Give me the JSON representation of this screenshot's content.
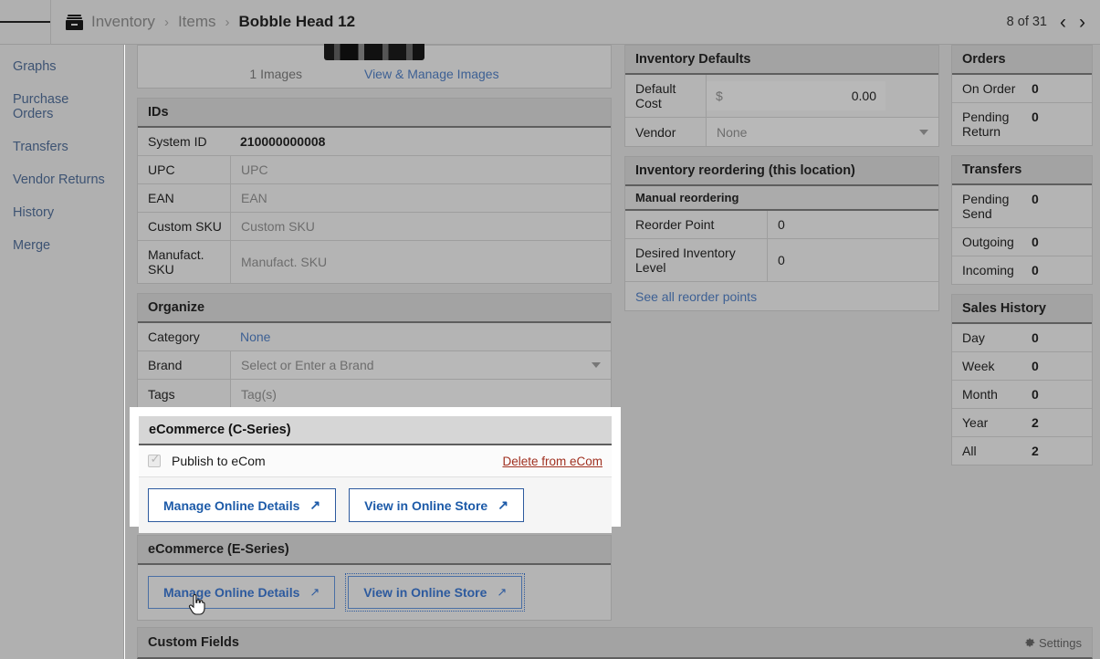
{
  "topbar": {
    "menu_icon": "hamburger-icon",
    "inventory_icon": "inventory-box-icon",
    "breadcrumb": [
      "Inventory",
      "Items",
      "Bobble Head 12"
    ],
    "separator": "›",
    "pager_count": "8 of 31",
    "prev_icon": "‹",
    "next_icon": "›"
  },
  "sidebar": {
    "items": [
      {
        "label": "Graphs"
      },
      {
        "label": "Purchase Orders"
      },
      {
        "label": "Transfers"
      },
      {
        "label": "Vendor Returns"
      },
      {
        "label": "History"
      },
      {
        "label": "Merge"
      }
    ]
  },
  "images": {
    "count_label": "1 Images",
    "manage_link": "View & Manage Images"
  },
  "ids": {
    "title": "IDs",
    "rows": [
      {
        "label": "System ID",
        "value": "210000000008",
        "bold": true
      },
      {
        "label": "UPC",
        "value": "UPC",
        "placeholder": true
      },
      {
        "label": "EAN",
        "value": "EAN",
        "placeholder": true
      },
      {
        "label": "Custom SKU",
        "value": "Custom SKU",
        "placeholder": true
      },
      {
        "label": "Manufact. SKU",
        "value": "Manufact. SKU",
        "placeholder": true
      }
    ]
  },
  "organize": {
    "title": "Organize",
    "category_label": "Category",
    "category_value": "None",
    "brand_label": "Brand",
    "brand_placeholder": "Select or Enter a Brand",
    "tags_label": "Tags",
    "tags_placeholder": "Tag(s)"
  },
  "inventory_defaults": {
    "title": "Inventory Defaults",
    "default_cost_label": "Default Cost",
    "currency_symbol": "$",
    "default_cost_value": "0.00",
    "vendor_label": "Vendor",
    "vendor_value": "None"
  },
  "reordering": {
    "title": "Inventory reordering (this location)",
    "subtitle": "Manual reordering",
    "reorder_point_label": "Reorder Point",
    "reorder_point_value": "0",
    "desired_level_label": "Desired Inventory Level",
    "desired_level_value": "0",
    "see_all_link": "See all reorder points"
  },
  "ecommerce_c": {
    "title": "eCommerce (C-Series)",
    "publish_label": "Publish to eCom",
    "publish_checked": true,
    "delete_link": "Delete from eCom",
    "manage_button": "Manage Online Details",
    "view_button": "View in Online Store",
    "external_icon": "↗"
  },
  "ecommerce_e": {
    "title": "eCommerce (E-Series)",
    "manage_button": "Manage Online Details",
    "view_button": "View in Online Store",
    "external_icon": "↗"
  },
  "custom_fields": {
    "title": "Custom Fields",
    "settings_label": "Settings",
    "settings_icon": "gear-icon"
  },
  "orders": {
    "title": "Orders",
    "rows": [
      {
        "label": "On Order",
        "value": "0"
      },
      {
        "label": "Pending Return",
        "value": "0"
      }
    ]
  },
  "transfers": {
    "title": "Transfers",
    "rows": [
      {
        "label": "Pending Send",
        "value": "0"
      },
      {
        "label": "Outgoing",
        "value": "0"
      },
      {
        "label": "Incoming",
        "value": "0"
      }
    ]
  },
  "sales_history": {
    "title": "Sales History",
    "rows": [
      {
        "label": "Day",
        "value": "0"
      },
      {
        "label": "Week",
        "value": "0"
      },
      {
        "label": "Month",
        "value": "0"
      },
      {
        "label": "Year",
        "value": "2"
      },
      {
        "label": "All",
        "value": "2"
      }
    ]
  },
  "colors": {
    "link": "#3d6094",
    "button_blue": "#2d5a9e",
    "delete_red": "#a03020",
    "page_bg": "#aaaaaa"
  }
}
